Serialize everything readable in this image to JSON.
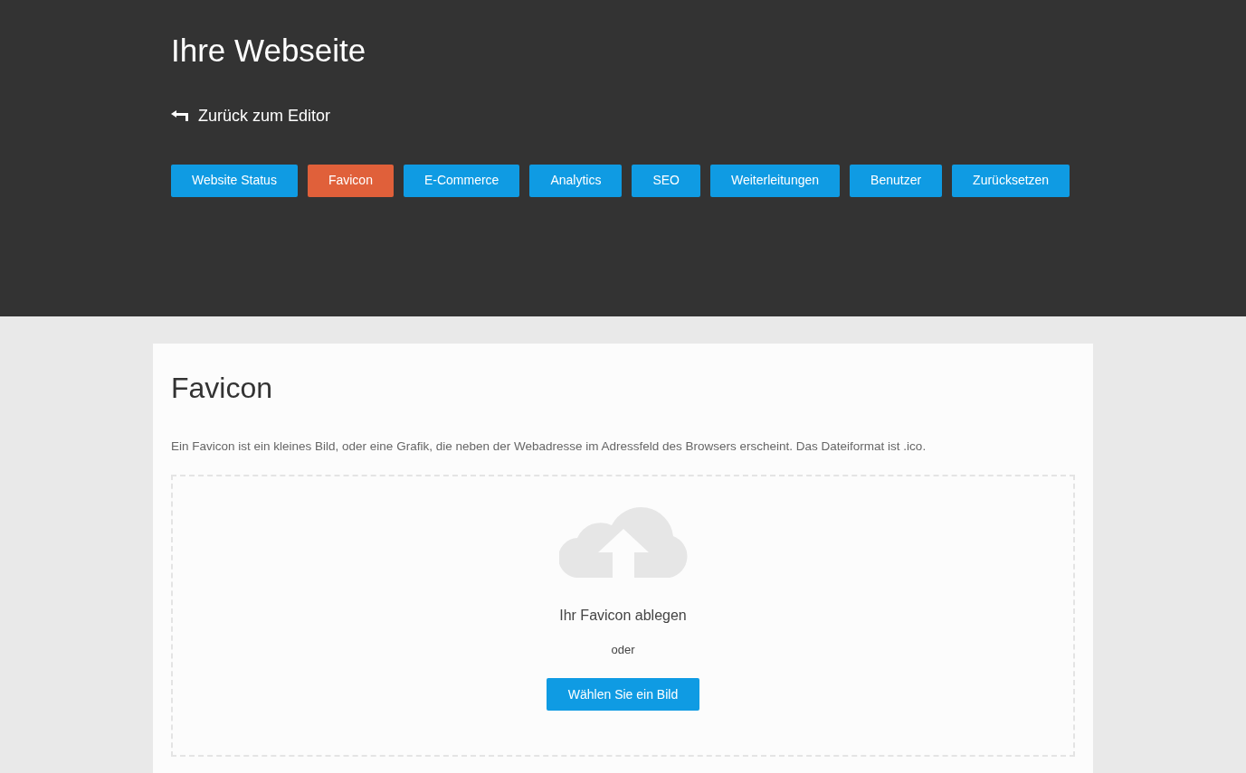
{
  "header": {
    "title": "Ihre Webseite",
    "back_link": "Zurück zum Editor"
  },
  "tabs": [
    {
      "label": "Website Status",
      "selected": false
    },
    {
      "label": "Favicon",
      "selected": true
    },
    {
      "label": "E-Commerce",
      "selected": false
    },
    {
      "label": "Analytics",
      "selected": false
    },
    {
      "label": "SEO",
      "selected": false
    },
    {
      "label": "Weiterleitungen",
      "selected": false
    },
    {
      "label": "Benutzer",
      "selected": false
    },
    {
      "label": "Zurücksetzen",
      "selected": false
    }
  ],
  "panel": {
    "title": "Favicon",
    "description": "Ein Favicon ist ein kleines Bild, oder eine Grafik, die neben der Webadresse im Adressfeld des Browsers erscheint. Das Dateiformat ist .ico.",
    "dropzone": {
      "prompt": "Ihr Favicon ablegen",
      "separator": "oder",
      "button": "Wählen Sie ein Bild"
    }
  }
}
